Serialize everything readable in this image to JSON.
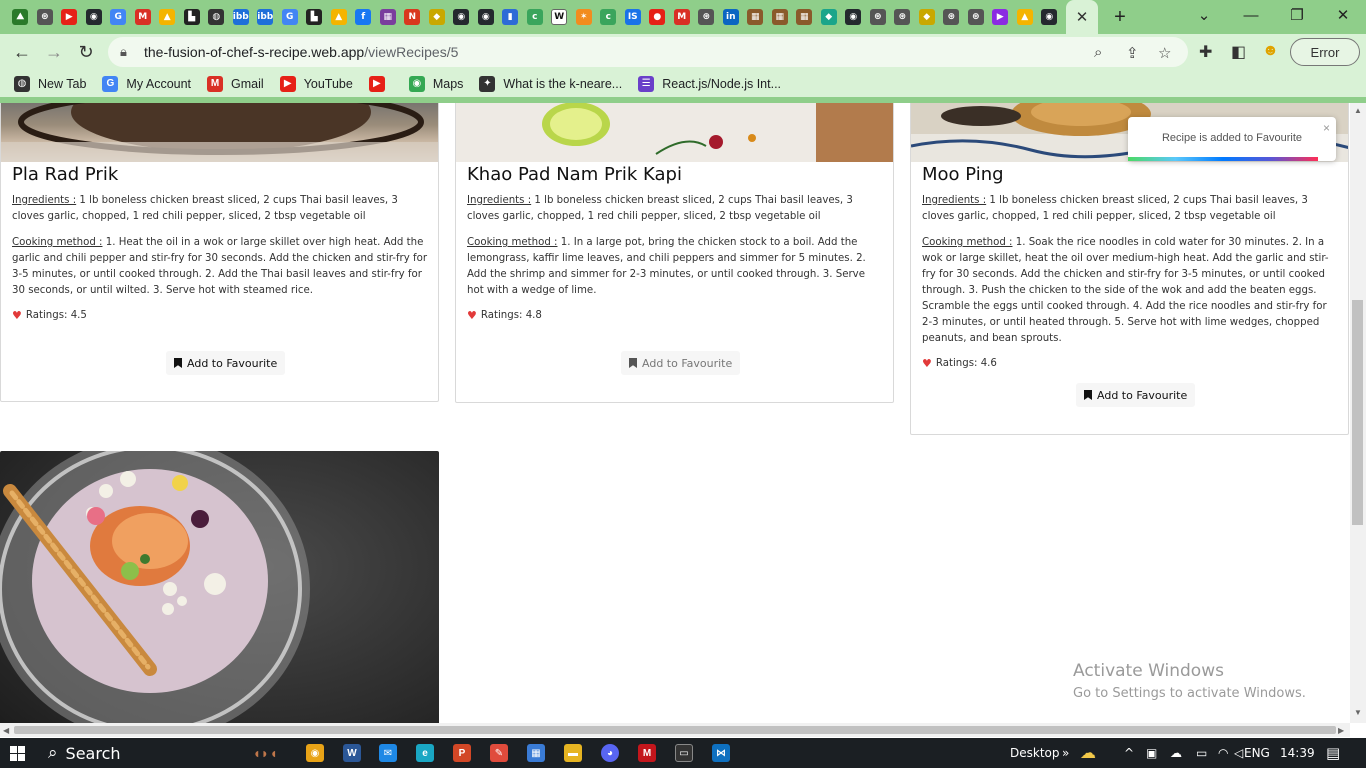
{
  "browser": {
    "tab_favicons": [
      {
        "icon": "kiwi-icon",
        "color": "#2a7a2a",
        "glyph": "⛰"
      },
      {
        "icon": "chrome-icon",
        "color": "#555555",
        "glyph": "⊛"
      },
      {
        "icon": "youtube-icon",
        "color": "#e62117",
        "glyph": "▶"
      },
      {
        "icon": "github-icon",
        "color": "#24292e",
        "glyph": "◉"
      },
      {
        "icon": "google-icon",
        "color": "#4285f4",
        "glyph": "G"
      },
      {
        "icon": "gmail-icon",
        "color": "#d93025",
        "glyph": "M"
      },
      {
        "icon": "drive-icon",
        "color": "#f4b400",
        "glyph": "▲"
      },
      {
        "icon": "app-icon",
        "color": "#222222",
        "glyph": "▙"
      },
      {
        "icon": "globe-icon",
        "color": "#333333",
        "glyph": "◍"
      },
      {
        "icon": "ibb-icon",
        "color": "#1e6fd9",
        "glyph": "ibb"
      },
      {
        "icon": "ibb-icon",
        "color": "#1e6fd9",
        "glyph": "ibb"
      },
      {
        "icon": "google-icon",
        "color": "#4285f4",
        "glyph": "G"
      },
      {
        "icon": "app-icon",
        "color": "#222222",
        "glyph": "▙"
      },
      {
        "icon": "drive-icon",
        "color": "#f4b400",
        "glyph": "▲"
      },
      {
        "icon": "facebook-icon",
        "color": "#1877f2",
        "glyph": "f"
      },
      {
        "icon": "image-icon",
        "color": "#7a3e9d",
        "glyph": "▦"
      },
      {
        "icon": "notion-icon",
        "color": "#d9381e",
        "glyph": "N"
      },
      {
        "icon": "maps-icon",
        "color": "#c9a800",
        "glyph": "◆"
      },
      {
        "icon": "github-icon",
        "color": "#24292e",
        "glyph": "◉"
      },
      {
        "icon": "github-icon",
        "color": "#24292e",
        "glyph": "◉"
      },
      {
        "icon": "doc-icon",
        "color": "#2d6bd6",
        "glyph": "▮"
      },
      {
        "icon": "c-icon",
        "color": "#3aa55c",
        "glyph": "c"
      },
      {
        "icon": "wiki-icon",
        "color": "#ffffff",
        "glyph": "W"
      },
      {
        "icon": "star-icon",
        "color": "#f28c1e",
        "glyph": "✶"
      },
      {
        "icon": "c-icon",
        "color": "#3aa55c",
        "glyph": "c"
      },
      {
        "icon": "is-icon",
        "color": "#1a73e8",
        "glyph": "IS"
      },
      {
        "icon": "record-icon",
        "color": "#e62117",
        "glyph": "●"
      },
      {
        "icon": "gmail-icon",
        "color": "#d93025",
        "glyph": "M"
      },
      {
        "icon": "chrome-icon",
        "color": "#555555",
        "glyph": "⊛"
      },
      {
        "icon": "linkedin-icon",
        "color": "#0a66c2",
        "glyph": "in"
      },
      {
        "icon": "image-icon",
        "color": "#8a5a2b",
        "glyph": "▦"
      },
      {
        "icon": "image-icon",
        "color": "#8a5a2b",
        "glyph": "▦"
      },
      {
        "icon": "image-icon",
        "color": "#8a5a2b",
        "glyph": "▦"
      },
      {
        "icon": "diamond-icon",
        "color": "#1aa58a",
        "glyph": "◆"
      },
      {
        "icon": "github-icon",
        "color": "#24292e",
        "glyph": "◉"
      },
      {
        "icon": "chrome-icon",
        "color": "#555555",
        "glyph": "⊛"
      },
      {
        "icon": "chrome-icon",
        "color": "#555555",
        "glyph": "⊛"
      },
      {
        "icon": "maps-icon",
        "color": "#c9a800",
        "glyph": "◆"
      },
      {
        "icon": "chrome-icon",
        "color": "#555555",
        "glyph": "⊛"
      },
      {
        "icon": "chrome-icon",
        "color": "#555555",
        "glyph": "⊛"
      },
      {
        "icon": "play-icon",
        "color": "#8b2be2",
        "glyph": "▶"
      },
      {
        "icon": "drive-icon",
        "color": "#f4b400",
        "glyph": "▲"
      },
      {
        "icon": "github-icon",
        "color": "#24292e",
        "glyph": "◉"
      }
    ],
    "new_tab_glyph": "+",
    "url_host": "the-fusion-of-chef-s-recipe.web.app",
    "url_path": "/viewRecipes/5",
    "profile_button": "Error"
  },
  "bookmarks": [
    {
      "label": "New Tab",
      "icon": "globe-icon",
      "color": "#333333",
      "glyph": "◍"
    },
    {
      "label": "My Account",
      "icon": "google-icon",
      "color": "#4285f4",
      "glyph": "G"
    },
    {
      "label": "Gmail",
      "icon": "gmail-icon",
      "color": "#d93025",
      "glyph": "M"
    },
    {
      "label": "YouTube",
      "icon": "youtube-icon",
      "color": "#e62117",
      "glyph": "▶"
    },
    {
      "label": "",
      "icon": "youtube-icon",
      "color": "#e62117",
      "glyph": "▶"
    },
    {
      "label": "Maps",
      "icon": "maps-pin-icon",
      "color": "#34a853",
      "glyph": "◉"
    },
    {
      "label": "What is the k-neare...",
      "icon": "ai-icon",
      "color": "#333333",
      "glyph": "✦"
    },
    {
      "label": "React.js/Node.js Int...",
      "icon": "list-icon",
      "color": "#6a3fc9",
      "glyph": "☰"
    }
  ],
  "recipes": [
    {
      "title": "Pla Rad Prik",
      "ingredients_label": "Ingredients :",
      "ingredients": "1 lb boneless chicken breast sliced, 2 cups Thai basil leaves, 3 cloves garlic, chopped, 1 red chili pepper, sliced, 2 tbsp vegetable oil",
      "method_label": "Cooking method :",
      "method": "1. Heat the oil in a wok or large skillet over high heat. Add the garlic and chili pepper and stir-fry for 30 seconds. Add the chicken and stir-fry for 3-5 minutes, or until cooked through. 2. Add the Thai basil leaves and stir-fry for 30 seconds, or until wilted. 3. Serve hot with steamed rice.",
      "rating": "Ratings: 4.5",
      "button": "Add to Favourite"
    },
    {
      "title": "Khao Pad Nam Prik Kapi",
      "ingredients_label": "Ingredients :",
      "ingredients": "1 lb boneless chicken breast sliced, 2 cups Thai basil leaves, 3 cloves garlic, chopped, 1 red chili pepper, sliced, 2 tbsp vegetable oil",
      "method_label": "Cooking method :",
      "method": "1. In a large pot, bring the chicken stock to a boil. Add the lemongrass, kaffir lime leaves, and chili peppers and simmer for 5 minutes. 2. Add the shrimp and simmer for 2-3 minutes, or until cooked through. 3. Serve hot with a wedge of lime.",
      "rating": "Ratings: 4.8",
      "button": "Add to Favourite"
    },
    {
      "title": "Moo Ping",
      "ingredients_label": "Ingredients :",
      "ingredients": "1 lb boneless chicken breast sliced, 2 cups Thai basil leaves, 3 cloves garlic, chopped, 1 red chili pepper, sliced, 2 tbsp vegetable oil",
      "method_label": "Cooking method :",
      "method": "1. Soak the rice noodles in cold water for 30 minutes. 2. In a wok or large skillet, heat the oil over medium-high heat. Add the garlic and stir-fry for 30 seconds. Add the chicken and stir-fry for 3-5 minutes, or until cooked through. 3. Push the chicken to the side of the wok and add the beaten eggs. Scramble the eggs until cooked through. 4. Add the rice noodles and stir-fry for 2-3 minutes, or until heated through. 5. Serve hot with lime wedges, chopped peanuts, and bean sprouts.",
      "rating": "Ratings: 4.6",
      "button": "Add to Favourite"
    }
  ],
  "toast": {
    "message": "Recipe is added to Favourite",
    "close": "×"
  },
  "watermark": {
    "line1": "Activate Windows",
    "line2": "Go to Settings to activate Windows."
  },
  "taskbar": {
    "search": "Search",
    "desktop_label": "Desktop",
    "language": "ENG",
    "time": "14:39"
  }
}
